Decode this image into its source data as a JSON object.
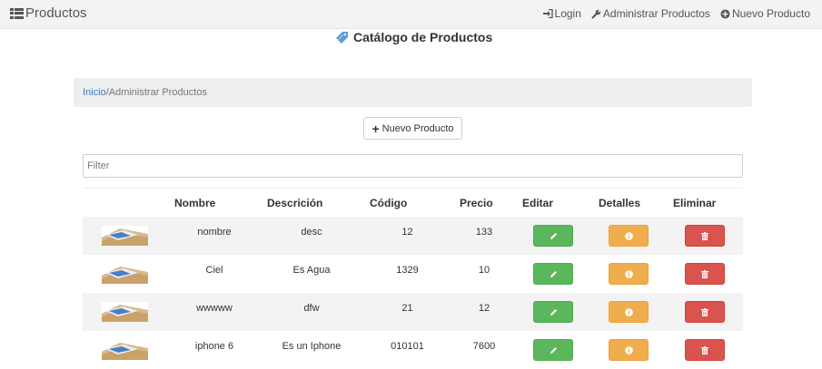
{
  "navbar": {
    "brand": "Productos",
    "brand_icon": "list-icon",
    "links": [
      {
        "label": "Login",
        "icon": "login-icon"
      },
      {
        "label": "Administrar Productos",
        "icon": "wrench-icon"
      },
      {
        "label": "Nuevo Producto",
        "icon": "plus-circle-icon"
      }
    ]
  },
  "page": {
    "title": "Catálogo de Productos",
    "title_icon": "tag-icon"
  },
  "breadcrumb": {
    "home": "Inicio",
    "separator": "/",
    "current": "Administrar Productos"
  },
  "new_button": {
    "label": "Nuevo Producto",
    "icon": "plus-icon"
  },
  "filter": {
    "placeholder": "Filter",
    "value": ""
  },
  "table": {
    "headers": [
      "",
      "Nombre",
      "Descrición",
      "Código",
      "Precio",
      "Editar",
      "Detalles",
      "Eliminar"
    ],
    "rows": [
      {
        "nombre": "nombre",
        "descripcion": "desc",
        "codigo": "12",
        "precio": "133"
      },
      {
        "nombre": "Ciel",
        "descripcion": "Es Agua",
        "codigo": "1329",
        "precio": "10"
      },
      {
        "nombre": "wwwww",
        "descripcion": "dfw",
        "codigo": "21",
        "precio": "12"
      },
      {
        "nombre": "iphone 6",
        "descripcion": "Es un Iphone",
        "codigo": "010101",
        "precio": "7600"
      }
    ],
    "row_icons": {
      "edit": "pencil-icon",
      "details": "info-icon",
      "delete": "trash-icon"
    }
  },
  "colors": {
    "navbar_bg": "#f3f3f3",
    "link": "#3f7cc6",
    "edit": "#5bb75b",
    "details": "#f0ad4e",
    "delete": "#d9534f",
    "stripe": "#f3f3f3"
  }
}
